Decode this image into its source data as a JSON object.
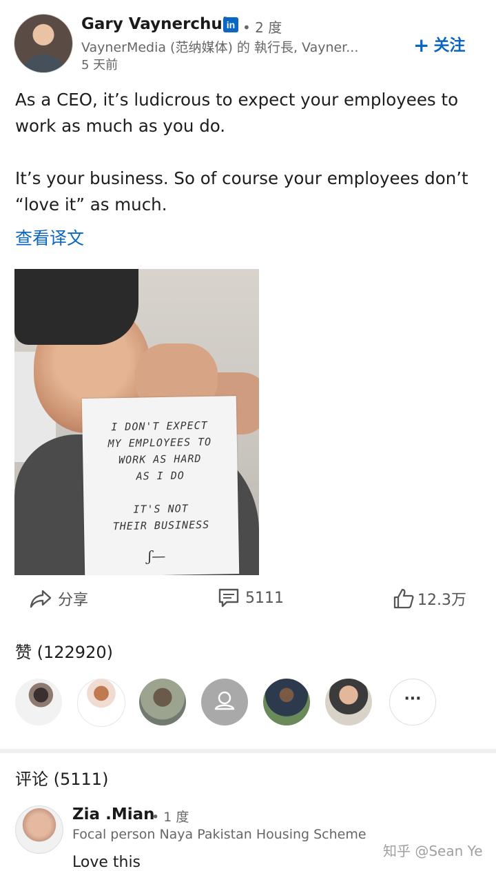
{
  "post": {
    "author_name": "Gary Vaynerchuk",
    "linkedin_badge": "in",
    "degree": "• 2 度",
    "headline": "VaynerMedia (范纳媒体) 的 執行長, Vayner...",
    "time": "5 天前",
    "follow_label": "关注",
    "paragraph1": "As a CEO, it’s ludicrous to expect your employees to work as much as you do.",
    "paragraph2": "It’s your business. So of course your employees don’t “love it” as much.",
    "translate_link": "查看译文"
  },
  "image": {
    "sign_line1": "I DON'T EXPECT",
    "sign_line2": "MY EMPLOYEES TO",
    "sign_line3": "WORK AS HARD",
    "sign_line4": "AS I DO",
    "sign_line5": "IT'S NOT",
    "sign_line6": "THEIR BUSINESS",
    "signature": "ʃ—"
  },
  "actions": {
    "share_label": "分享",
    "comment_count": "5111",
    "like_count": "12.3万"
  },
  "likes": {
    "title": "赞 (122920)",
    "more_label": "···"
  },
  "comments": {
    "title": "评论 (5111)",
    "first": {
      "name": "Zia .Mian",
      "degree": "• 1 度",
      "headline": "Focal person Naya Pakistan Housing Scheme",
      "text": "Love this"
    }
  },
  "watermark": "知乎 @Sean Ye",
  "colors": {
    "accent": "#0a66c2",
    "muted": "#666666"
  }
}
